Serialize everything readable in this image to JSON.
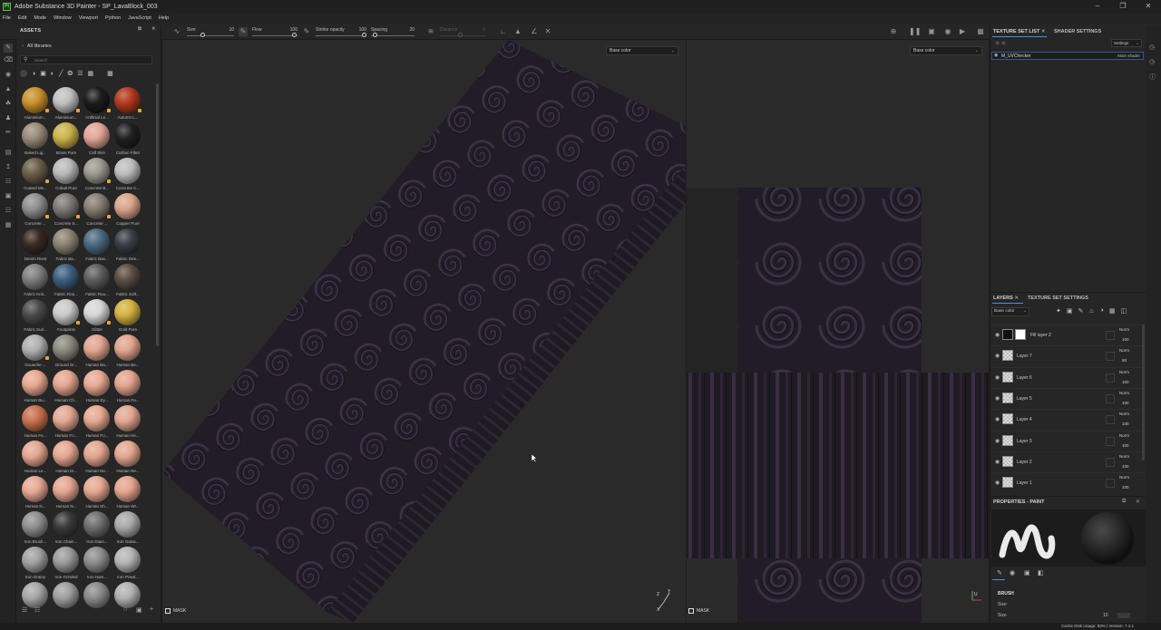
{
  "window": {
    "title": "Adobe Substance 3D Painter - SP_LavaBlock_003",
    "app_icon": "Pt"
  },
  "menu": [
    "File",
    "Edit",
    "Mode",
    "Window",
    "Viewport",
    "Python",
    "JavaScript",
    "Help"
  ],
  "toolbar": {
    "size": {
      "label": "Size",
      "value": "10"
    },
    "flow": {
      "label": "Flow",
      "value": "100"
    },
    "stroke_opacity": {
      "label": "Stroke opacity",
      "value": "100"
    },
    "spacing": {
      "label": "Spacing",
      "value": "20"
    },
    "distance": {
      "label": "Distance",
      "value": "0"
    }
  },
  "assets": {
    "title": "ASSETS",
    "library": "All libraries",
    "search_placeholder": "Search",
    "items": [
      {
        "label": "Aluminium...",
        "color": "#c8902a",
        "dl": true
      },
      {
        "label": "Aluminium...",
        "color": "#bfbfbf",
        "dl": true
      },
      {
        "label": "Artificial Le...",
        "color": "#1c1c1c",
        "dl": true
      },
      {
        "label": "Autumn L...",
        "color": "#b23a1e",
        "dl": true
      },
      {
        "label": "Baked Lig...",
        "color": "#9a8a78",
        "dl": false
      },
      {
        "label": "Brass Pure",
        "color": "#c9b24a",
        "dl": false
      },
      {
        "label": "Calf Skin",
        "color": "#e2a596",
        "dl": false
      },
      {
        "label": "Carbon Fiber",
        "color": "#202020",
        "dl": false
      },
      {
        "label": "Coated Me...",
        "color": "#6a5e48",
        "dl": true
      },
      {
        "label": "Cobalt Pure",
        "color": "#b9b9b9",
        "dl": false
      },
      {
        "label": "Concrete B...",
        "color": "#9c9890",
        "dl": true
      },
      {
        "label": "Concrete C...",
        "color": "#bcbcbc",
        "dl": false
      },
      {
        "label": "Concrete ...",
        "color": "#8e8e8e",
        "dl": true
      },
      {
        "label": "Concrete S...",
        "color": "#7d7a74",
        "dl": true
      },
      {
        "label": "Concrete ...",
        "color": "#857d70",
        "dl": true
      },
      {
        "label": "Copper Pure",
        "color": "#d9a48a",
        "dl": false
      },
      {
        "label": "Denim Rivet",
        "color": "#3a2a22",
        "dl": false
      },
      {
        "label": "Fabric Ba...",
        "color": "#8a8470",
        "dl": false
      },
      {
        "label": "Fabric Bas...",
        "color": "#4a6a80",
        "dl": false
      },
      {
        "label": "Fabric Den...",
        "color": "#3a3d45",
        "dl": false
      },
      {
        "label": "Fabric Knit...",
        "color": "#7e7e7e",
        "dl": false
      },
      {
        "label": "Fabric Rou...",
        "color": "#3e5f80",
        "dl": false
      },
      {
        "label": "Fabric Rou...",
        "color": "#5d5d5d",
        "dl": false
      },
      {
        "label": "Fabric Soft...",
        "color": "#5a4e44",
        "dl": false
      },
      {
        "label": "Fabric Suit...",
        "color": "#4a4a4a",
        "dl": false
      },
      {
        "label": "Footprints",
        "color": "#c9c9c9",
        "dl": true
      },
      {
        "label": "Glitter",
        "color": "#d6d6d6",
        "dl": true
      },
      {
        "label": "Gold Pure",
        "color": "#d2b240",
        "dl": false
      },
      {
        "label": "Gouache ...",
        "color": "#b0b0b0",
        "dl": true
      },
      {
        "label": "Ground Gr...",
        "color": "#8a8a7c",
        "dl": false
      },
      {
        "label": "Human Ba...",
        "color": "#e2a590",
        "dl": false
      },
      {
        "label": "Human Be...",
        "color": "#e0a48e",
        "dl": false
      },
      {
        "label": "Human Bu...",
        "color": "#e6a890",
        "dl": false
      },
      {
        "label": "Human Ch...",
        "color": "#e4a690",
        "dl": false
      },
      {
        "label": "Human Ey...",
        "color": "#e6a994",
        "dl": false
      },
      {
        "label": "Human Fa...",
        "color": "#e2a48e",
        "dl": false
      },
      {
        "label": "Human Fe...",
        "color": "#c8704e",
        "dl": false
      },
      {
        "label": "Human Fo...",
        "color": "#e4a792",
        "dl": false
      },
      {
        "label": "Human Fo...",
        "color": "#e6a892",
        "dl": false
      },
      {
        "label": "Human He...",
        "color": "#e2a590",
        "dl": false
      },
      {
        "label": "Human Le...",
        "color": "#e4a690",
        "dl": false
      },
      {
        "label": "Human M...",
        "color": "#e5a791",
        "dl": false
      },
      {
        "label": "Human Ne...",
        "color": "#e3a58f",
        "dl": false
      },
      {
        "label": "Human Ne...",
        "color": "#e4a690",
        "dl": false
      },
      {
        "label": "Human N...",
        "color": "#e5a892",
        "dl": false
      },
      {
        "label": "Human N...",
        "color": "#e3a690",
        "dl": false
      },
      {
        "label": "Human Sh...",
        "color": "#e4a791",
        "dl": false
      },
      {
        "label": "Human Wr...",
        "color": "#e2a48e",
        "dl": false
      },
      {
        "label": "Iron Brush...",
        "color": "#8e8e8e",
        "dl": false
      },
      {
        "label": "Iron Chain...",
        "color": "#3a3a3a",
        "dl": false
      },
      {
        "label": "Iron Diam...",
        "color": "#6e6e6e",
        "dl": false
      },
      {
        "label": "Iron Galva...",
        "color": "#a8a8a8",
        "dl": false
      },
      {
        "label": "Iron Grainy",
        "color": "#a0a0a0",
        "dl": false
      },
      {
        "label": "Iron Grinded",
        "color": "#9a9a9a",
        "dl": false
      },
      {
        "label": "Iron Ham...",
        "color": "#8c8c8c",
        "dl": false
      },
      {
        "label": "Iron Powd...",
        "color": "#b4b4b4",
        "dl": false
      },
      {
        "label": "",
        "color": "#a6a6a6",
        "dl": false
      },
      {
        "label": "",
        "color": "#9e9e9e",
        "dl": false
      },
      {
        "label": "",
        "color": "#8a8a8a",
        "dl": false
      },
      {
        "label": "",
        "color": "#b0b0b0",
        "dl": false
      }
    ]
  },
  "viewport": {
    "channel": "Base color",
    "mask_label": "MASK"
  },
  "uv_view": {
    "channel": "Base color",
    "mask_label": "MASK"
  },
  "texture_set_list": {
    "tab1": "TEXTURE SET LIST",
    "tab2": "SHADER SETTINGS",
    "settings_button": "Settings",
    "entry": {
      "name": "M_UVChecker",
      "shader": "Main shader"
    }
  },
  "layers": {
    "tab1": "LAYERS",
    "tab2": "TEXTURE SET SETTINGS",
    "channel": "Base color",
    "items": [
      {
        "name": "Fill layer 2",
        "blend": "Norm",
        "opacity": "100",
        "fill": true
      },
      {
        "name": "Layer 7",
        "blend": "Norm",
        "opacity": "60",
        "fill": false
      },
      {
        "name": "Layer 6",
        "blend": "Norm",
        "opacity": "100",
        "fill": false
      },
      {
        "name": "Layer 5",
        "blend": "Norm",
        "opacity": "100",
        "fill": false
      },
      {
        "name": "Layer 4",
        "blend": "Norm",
        "opacity": "100",
        "fill": false
      },
      {
        "name": "Layer 3",
        "blend": "Norm",
        "opacity": "100",
        "fill": false
      },
      {
        "name": "Layer 2",
        "blend": "Norm",
        "opacity": "100",
        "fill": false
      },
      {
        "name": "Layer 1",
        "blend": "Norm",
        "opacity": "100",
        "fill": false
      }
    ]
  },
  "properties": {
    "title": "PROPERTIES - PAINT",
    "section": "BRUSH",
    "size_label": "Size",
    "size_label2": "Size",
    "size_value": "10"
  },
  "status": {
    "text": "Cache Disk Usage:  83% | Version: 7.4.1"
  }
}
